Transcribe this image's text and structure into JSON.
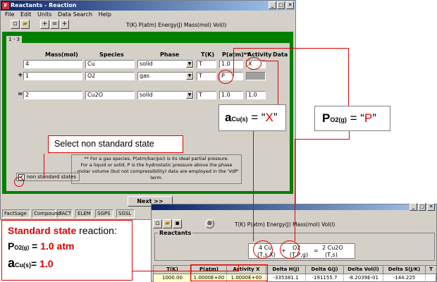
{
  "window1": {
    "title": "Reactants - Reaction",
    "icon_letter": "F",
    "menu": [
      "File",
      "Edit",
      "Units",
      "Data Search",
      "Help"
    ],
    "units_line": "T(K)  P(atm)  Energy(J)  Mass(mol)  Vol(l)",
    "tab_label": "1 - 3",
    "headers": {
      "mass": "Mass(mol)",
      "species": "Species",
      "phase": "Phase",
      "t": "T(K)",
      "p": "P(atm)**",
      "activity": "Activity",
      "data": "Data"
    },
    "rows": [
      {
        "sign": "",
        "mass": "4",
        "species": "Cu",
        "phase": "solid",
        "t": "T",
        "p": "1.0",
        "activity": "X"
      },
      {
        "sign": "+",
        "mass": "1",
        "species": "O2",
        "phase": "gas",
        "t": "T",
        "p": "P",
        "activity": ""
      },
      {
        "sign": "=",
        "mass": "2",
        "species": "Cu2O",
        "phase": "solid",
        "t": "T",
        "p": "1.0",
        "activity": "1.0"
      }
    ],
    "note_lines": [
      "** For a gas species, P(atm/bar/psi) is its ideal partial pressure.",
      "For a liquid or solid, P is the hydrostatic pressure above the phase",
      "- molar volume (but not compressibility) data are employed in the 'VdP' term."
    ],
    "checkbox_label": "non standard states",
    "checkbox_checked": "✔",
    "next_button": "Next >>",
    "status": [
      "FactSage",
      "Compound:",
      "FACT",
      "ELEM",
      "SGPS",
      "SGSL"
    ]
  },
  "window2": {
    "units_line": "T(K)  P(atm)  Energy(J)  Mass(mol)  Vol(l)",
    "section_label": "Reactants",
    "eq": [
      {
        "top": "4  Cu",
        "bottom": "(T,s,X)"
      },
      {
        "top": "+",
        "bottom": ""
      },
      {
        "top": "O2",
        "bottom": "(T,P,g)"
      },
      {
        "top": "=",
        "bottom": ""
      },
      {
        "top": "2  Cu2O",
        "bottom": "(T,s)"
      }
    ],
    "grid_headers": [
      "T(K)",
      "P(atm)",
      "Activity X",
      "Delta H(J)",
      "Delta G(J)",
      "Delta Vol(l)",
      "Delta S(J/K)",
      "T"
    ],
    "grid_row": [
      "1000.00",
      "1.0000E+00",
      "1.0000E+00",
      "-335381.1",
      "-191155.7",
      "-8.2039E-01",
      "-144.225",
      ""
    ]
  },
  "callouts": {
    "select_nonstandard": "Select non standard state",
    "a_cu_prefix": "a",
    "a_cu_sub": "Cu(s)",
    "a_cu_eq": " = “",
    "a_cu_val": "X",
    "a_cu_close": "”",
    "p_o2_prefix": "P",
    "p_o2_sub": "O2(g)",
    "p_o2_eq": " = “",
    "p_o2_val": "P",
    "p_o2_close": "”",
    "std_title_red": "Standard state",
    "std_title_black": " reaction:",
    "std_p_prefix": "P",
    "std_p_sub": "O2(g)",
    "std_p_eq": " = ",
    "std_p_val": "1.0 atm",
    "std_a_prefix": "a",
    "std_a_sub": "Cu(s)",
    "std_a_eq": "= ",
    "std_a_val": "1.0"
  },
  "colors": {
    "accent_red": "#e00000",
    "panel_green": "#008000"
  }
}
